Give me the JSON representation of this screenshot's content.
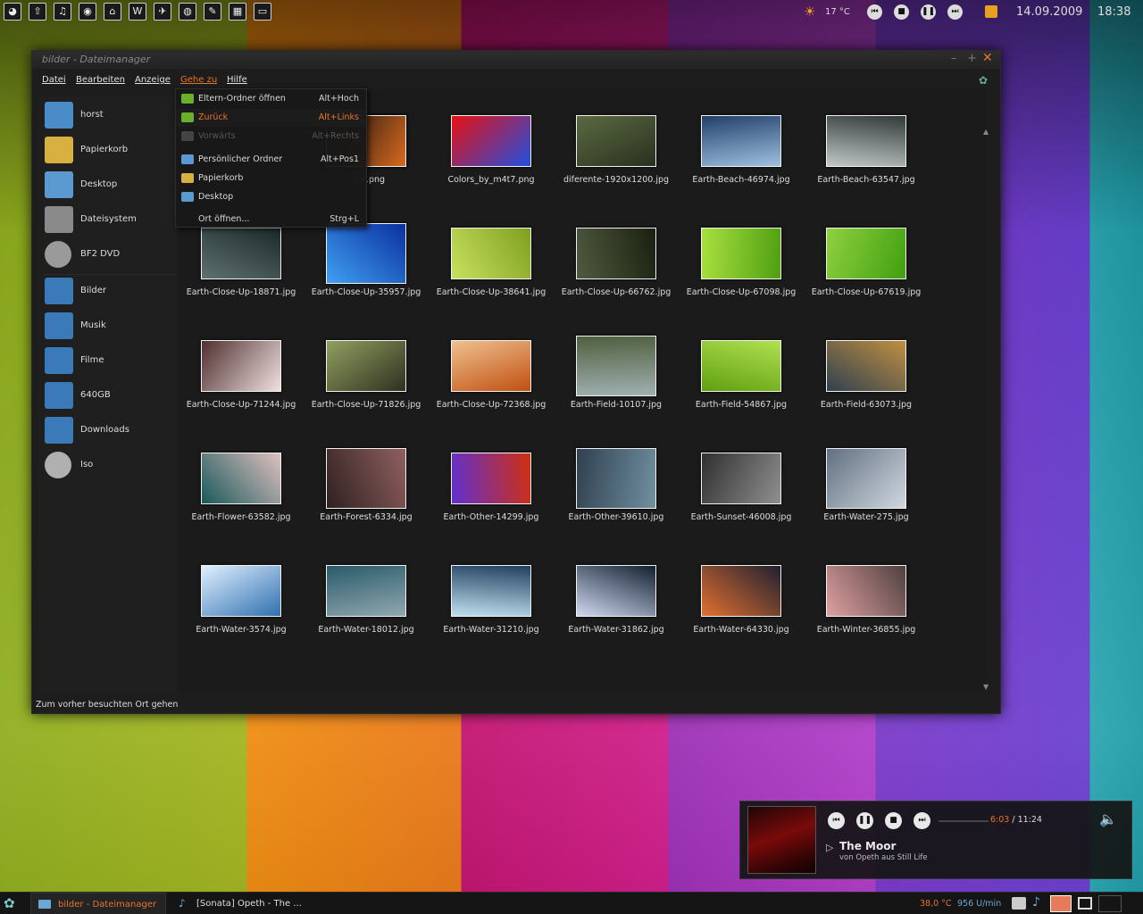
{
  "top_panel": {
    "launchers": [
      "app-launcher-1",
      "app-launcher-2",
      "app-launcher-3",
      "app-launcher-4",
      "app-launcher-5",
      "app-launcher-6",
      "app-launcher-7",
      "app-launcher-8",
      "app-launcher-9",
      "app-launcher-10",
      "app-launcher-11"
    ],
    "weather": "17 °C",
    "date": "14.09.2009",
    "time": "18:38"
  },
  "window": {
    "title": "bilder - Dateimanager",
    "menu": [
      "Datei",
      "Bearbeiten",
      "Anzeige",
      "Gehe zu",
      "Hilfe"
    ],
    "active_menu": "Gehe zu",
    "status": "Zum vorher besuchten Ort gehen"
  },
  "sidebar": {
    "places": [
      "horst",
      "Papierkorb",
      "Desktop",
      "Dateisystem",
      "BF2 DVD"
    ],
    "bookmarks": [
      "Bilder",
      "Musik",
      "Filme",
      "640GB",
      "Downloads",
      "Iso"
    ]
  },
  "goto_menu": [
    {
      "label": "Eltern-Ordner öffnen",
      "key": "Alt+Hoch",
      "state": "normal",
      "icon": "up-arrow-icon"
    },
    {
      "label": "Zurück",
      "key": "Alt+Links",
      "state": "highlight",
      "icon": "back-arrow-icon"
    },
    {
      "label": "Vorwärts",
      "key": "Alt+Rechts",
      "state": "disabled",
      "icon": "forward-arrow-icon"
    },
    {
      "label": "Persönlicher Ordner",
      "key": "Alt+Pos1",
      "state": "normal",
      "icon": "home-folder-icon"
    },
    {
      "label": "Papierkorb",
      "key": "",
      "state": "normal",
      "icon": "trash-icon"
    },
    {
      "label": "Desktop",
      "key": "",
      "state": "normal",
      "icon": "desktop-icon"
    },
    {
      "label": "Ort öffnen...",
      "key": "Strg+L",
      "state": "normal",
      "icon": ""
    }
  ],
  "files": [
    "…nk.png",
    "Colors_by_m4t7.png",
    "diferente-1920x1200.jpg",
    "Earth-Beach-46974.jpg",
    "Earth-Beach-63547.jpg",
    "Earth-Close-Up-18871.jpg",
    "Earth-Close-Up-35957.jpg",
    "Earth-Close-Up-38641.jpg",
    "Earth-Close-Up-66762.jpg",
    "Earth-Close-Up-67098.jpg",
    "Earth-Close-Up-67619.jpg",
    "Earth-Close-Up-71244.jpg",
    "Earth-Close-Up-71826.jpg",
    "Earth-Close-Up-72368.jpg",
    "Earth-Field-10107.jpg",
    "Earth-Field-54867.jpg",
    "Earth-Field-63073.jpg",
    "Earth-Flower-63582.jpg",
    "Earth-Forest-6334.jpg",
    "Earth-Other-14299.jpg",
    "Earth-Other-39610.jpg",
    "Earth-Sunset-46008.jpg",
    "Earth-Water-275.jpg",
    "Earth-Water-3574.jpg",
    "Earth-Water-18012.jpg",
    "Earth-Water-31210.jpg",
    "Earth-Water-31862.jpg",
    "Earth-Water-64330.jpg",
    "Earth-Winter-36855.jpg"
  ],
  "player": {
    "current_time": "6:03",
    "separator": " / ",
    "total_time": "11:24",
    "track": "The Moor",
    "subtitle": "von Opeth aus Still Life"
  },
  "taskbar": {
    "tasks": [
      "bilder - Dateimanager",
      "[Sonata] Opeth - The ..."
    ],
    "temperature": "38,0 °C",
    "fan": "956 U/min"
  },
  "colors": {
    "accent": "#e8742c",
    "menu_bg": "#181818",
    "window_bg": "#1d1d1d"
  }
}
